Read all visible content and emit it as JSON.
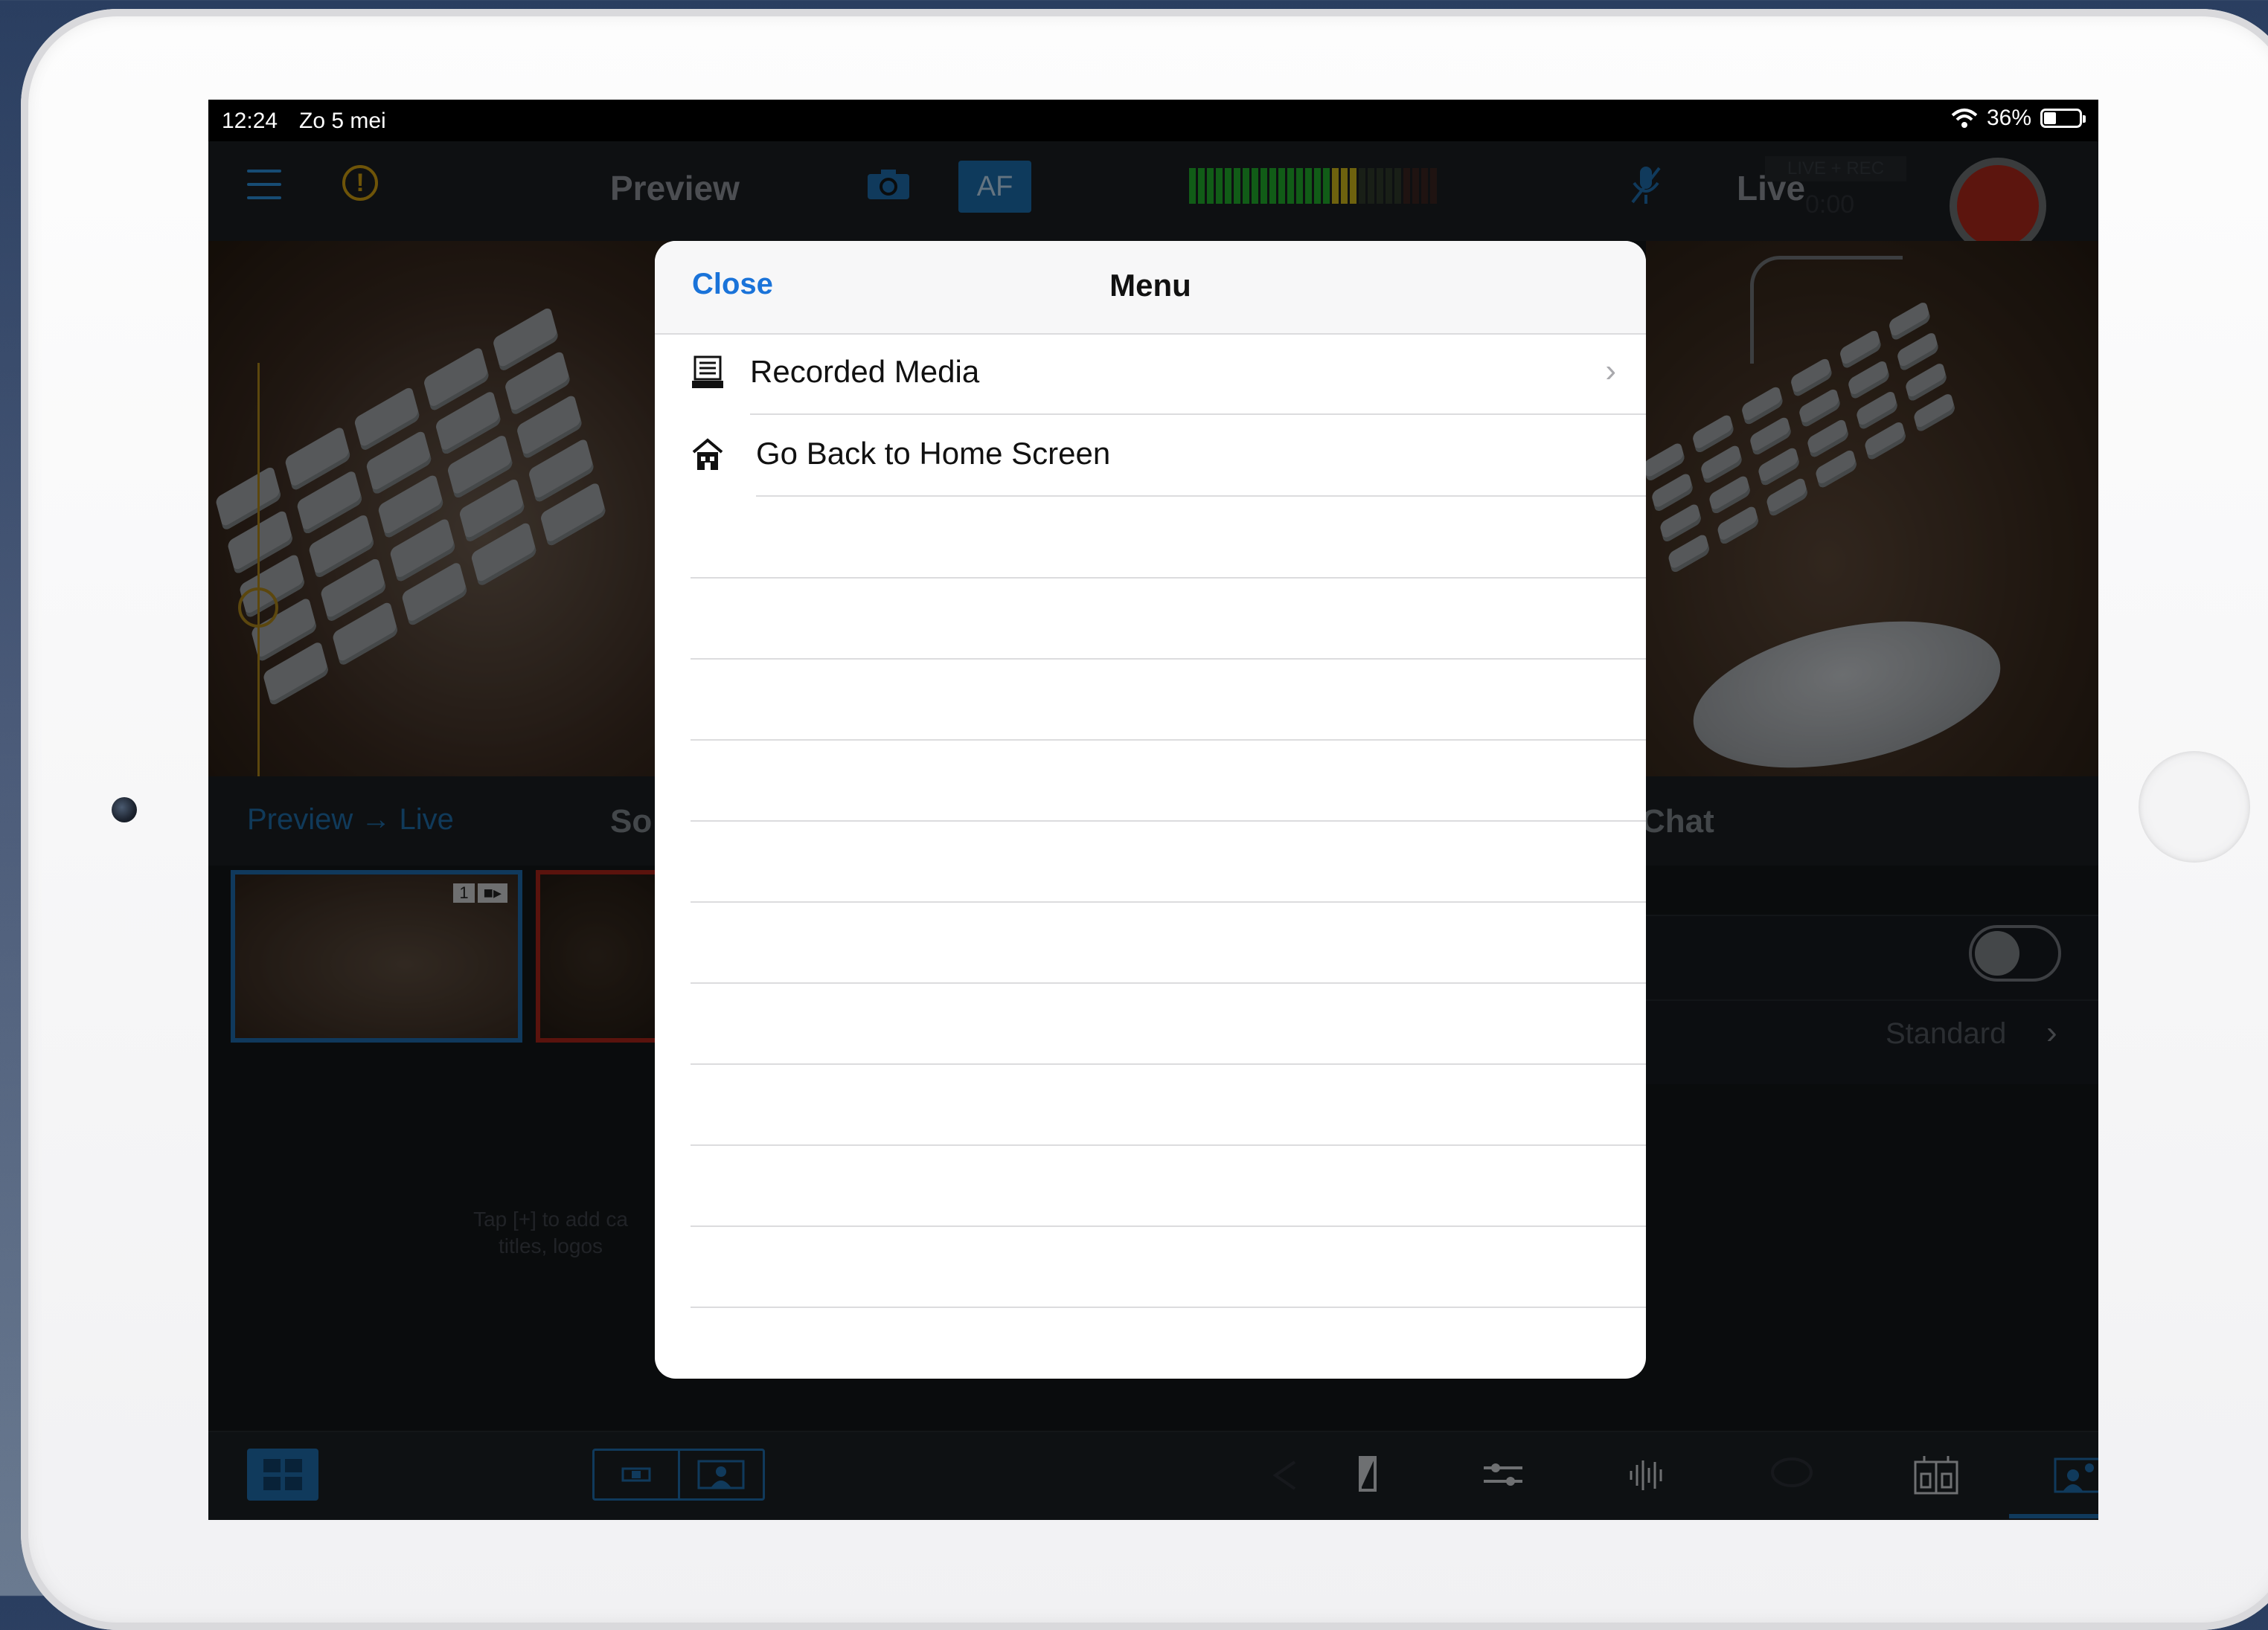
{
  "status_bar": {
    "time": "12:24",
    "date": "Zo 5 mei",
    "battery": "36%"
  },
  "toolbar": {
    "preview_label": "Preview",
    "af_label": "AF",
    "live_label": "Live",
    "live_rec_label": "LIVE + REC",
    "live_time": "0:00"
  },
  "audio_meter": {
    "lit_segments": 19,
    "total_segments": 28
  },
  "sources_panel": {
    "preview_live_label": "Preview → Live",
    "sources_label_partial": "So",
    "chat_label_partial": "Chat",
    "thumb1_number": "1",
    "hint_line1": "Tap [+] to add ca",
    "hint_line2": "titles, logos"
  },
  "settings_panel": {
    "toggle_on": false,
    "quality_value": "Standard"
  },
  "modal": {
    "close_label": "Close",
    "title": "Menu",
    "items": [
      {
        "label": "Recorded Media",
        "icon": "recorded-media-icon",
        "has_chevron": true
      },
      {
        "label": "Go Back to Home Screen",
        "icon": "home-icon",
        "has_chevron": false
      }
    ]
  },
  "colors": {
    "accent_blue": "#1a73d9",
    "toolbar_blue": "#1e6aa8",
    "record_red": "#a8271a",
    "warning_yellow": "#c99a10"
  }
}
